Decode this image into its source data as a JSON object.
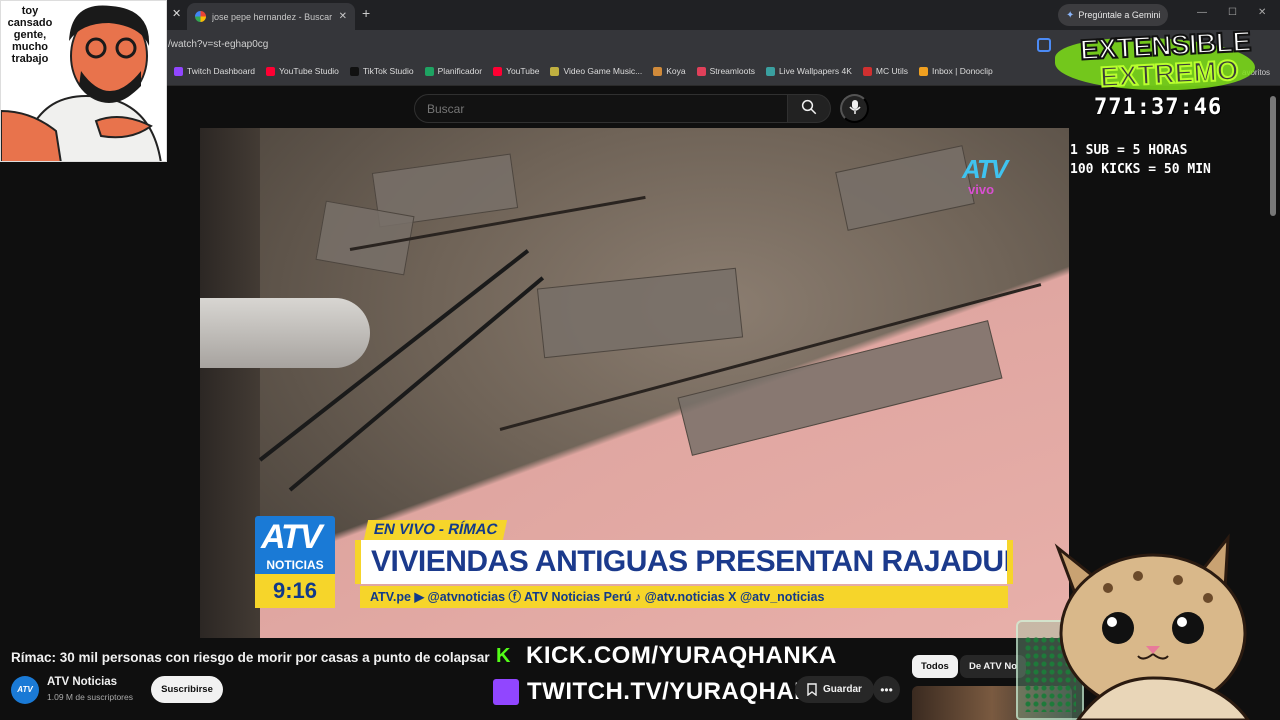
{
  "browser": {
    "active_tab_title": "jose pepe hernandez - Buscar c",
    "url": "/watch?v=st-eghap0cg",
    "gemini_label": "Pregúntale a Gemini",
    "bookmarks": [
      {
        "label": "Twitch Dashboard",
        "color": "#9146ff"
      },
      {
        "label": "YouTube Studio",
        "color": "#ff0033"
      },
      {
        "label": "TikTok Studio",
        "color": "#111111"
      },
      {
        "label": "Planificador",
        "color": "#1ea362"
      },
      {
        "label": "YouTube",
        "color": "#ff0033"
      },
      {
        "label": "Video Game Music...",
        "color": "#c0b040"
      },
      {
        "label": "Koya",
        "color": "#d08a3a"
      },
      {
        "label": "Streamloots",
        "color": "#e0405a"
      },
      {
        "label": "Live Wallpapers 4K",
        "color": "#3aa0a0"
      },
      {
        "label": "MC Utils",
        "color": "#d03030"
      },
      {
        "label": "Inbox | Donoclip",
        "color": "#f0a020"
      }
    ],
    "bookmarks_overflow": "avoritos"
  },
  "youtube": {
    "search_placeholder": "Buscar",
    "video_title": "Rímac: 30 mil personas con riesgo de morir por casas a punto de colapsar",
    "channel_name": "ATV Noticias",
    "channel_avatar_text": "ATV",
    "channel_subs": "1.09 M de suscriptores",
    "subscribe_label": "Suscribirse",
    "save_label": "Guardar",
    "chips": [
      "Todos",
      "De ATV No"
    ]
  },
  "broadcast": {
    "logo_text": "ATV",
    "logo_sub": "vivo",
    "brand_text": "ATV",
    "brand_sub": "NOTICIAS",
    "clock": "9:16",
    "tag": "EN VIVO - RÍMAC",
    "headline": "VIVIENDAS ANTIGUAS PRESENTAN RAJADURAS",
    "socials": "ATV.pe   ▶ @atvnoticias   ⓕ ATV Noticias Perú   ♪ @atv.noticias   X @atv_noticias"
  },
  "overlay": {
    "caption": "toy cansado gente, mucho trabajo",
    "logo_line1": "EXTENSIBLE",
    "logo_line2": "EXTREMO",
    "timer": "771:37:46",
    "rule1": "1 SUB = 5 HORAS",
    "rule2": "100 KICKS = 50 MIN",
    "kick": "KICK.COM/YURAQHANKA",
    "twitch": "TWITCH.TV/YURAQHANKAA"
  }
}
